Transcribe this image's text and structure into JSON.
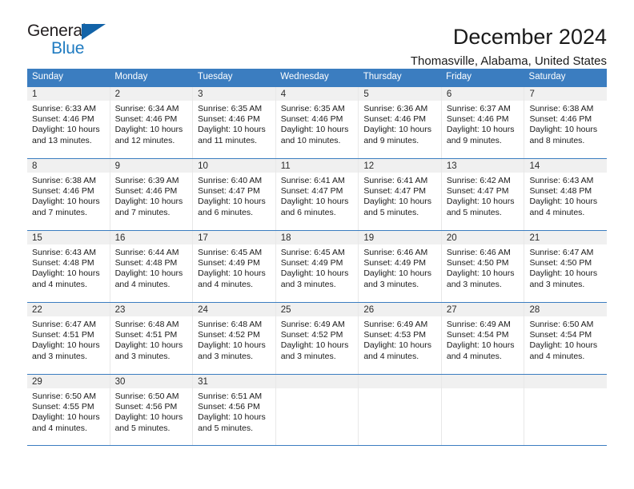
{
  "brand": {
    "name_top": "General",
    "name_bottom": "Blue",
    "triangle_icon": "brand-triangle-icon",
    "colors": {
      "general": "#231f20",
      "blue": "#1f7bc1",
      "triangle": "#1263a8"
    }
  },
  "header": {
    "title": "December 2024",
    "subtitle": "Thomasville, Alabama, United States"
  },
  "theme": {
    "header_row_bg": "#3b7dc0",
    "daynum_band_bg": "#f0f0f0",
    "rule_color": "#3b7dc0",
    "text": "#1a1a1a"
  },
  "columns": [
    "Sunday",
    "Monday",
    "Tuesday",
    "Wednesday",
    "Thursday",
    "Friday",
    "Saturday"
  ],
  "labels": {
    "sunrise_prefix": "Sunrise: ",
    "sunset_prefix": "Sunset: ",
    "daylight_prefix": "Daylight: "
  },
  "weeks": [
    [
      {
        "day": "1",
        "sunrise": "Sunrise: 6:33 AM",
        "sunset": "Sunset: 4:46 PM",
        "daylight_line1": "Daylight: 10 hours",
        "daylight_line2": "and 13 minutes."
      },
      {
        "day": "2",
        "sunrise": "Sunrise: 6:34 AM",
        "sunset": "Sunset: 4:46 PM",
        "daylight_line1": "Daylight: 10 hours",
        "daylight_line2": "and 12 minutes."
      },
      {
        "day": "3",
        "sunrise": "Sunrise: 6:35 AM",
        "sunset": "Sunset: 4:46 PM",
        "daylight_line1": "Daylight: 10 hours",
        "daylight_line2": "and 11 minutes."
      },
      {
        "day": "4",
        "sunrise": "Sunrise: 6:35 AM",
        "sunset": "Sunset: 4:46 PM",
        "daylight_line1": "Daylight: 10 hours",
        "daylight_line2": "and 10 minutes."
      },
      {
        "day": "5",
        "sunrise": "Sunrise: 6:36 AM",
        "sunset": "Sunset: 4:46 PM",
        "daylight_line1": "Daylight: 10 hours",
        "daylight_line2": "and 9 minutes."
      },
      {
        "day": "6",
        "sunrise": "Sunrise: 6:37 AM",
        "sunset": "Sunset: 4:46 PM",
        "daylight_line1": "Daylight: 10 hours",
        "daylight_line2": "and 9 minutes."
      },
      {
        "day": "7",
        "sunrise": "Sunrise: 6:38 AM",
        "sunset": "Sunset: 4:46 PM",
        "daylight_line1": "Daylight: 10 hours",
        "daylight_line2": "and 8 minutes."
      }
    ],
    [
      {
        "day": "8",
        "sunrise": "Sunrise: 6:38 AM",
        "sunset": "Sunset: 4:46 PM",
        "daylight_line1": "Daylight: 10 hours",
        "daylight_line2": "and 7 minutes."
      },
      {
        "day": "9",
        "sunrise": "Sunrise: 6:39 AM",
        "sunset": "Sunset: 4:46 PM",
        "daylight_line1": "Daylight: 10 hours",
        "daylight_line2": "and 7 minutes."
      },
      {
        "day": "10",
        "sunrise": "Sunrise: 6:40 AM",
        "sunset": "Sunset: 4:47 PM",
        "daylight_line1": "Daylight: 10 hours",
        "daylight_line2": "and 6 minutes."
      },
      {
        "day": "11",
        "sunrise": "Sunrise: 6:41 AM",
        "sunset": "Sunset: 4:47 PM",
        "daylight_line1": "Daylight: 10 hours",
        "daylight_line2": "and 6 minutes."
      },
      {
        "day": "12",
        "sunrise": "Sunrise: 6:41 AM",
        "sunset": "Sunset: 4:47 PM",
        "daylight_line1": "Daylight: 10 hours",
        "daylight_line2": "and 5 minutes."
      },
      {
        "day": "13",
        "sunrise": "Sunrise: 6:42 AM",
        "sunset": "Sunset: 4:47 PM",
        "daylight_line1": "Daylight: 10 hours",
        "daylight_line2": "and 5 minutes."
      },
      {
        "day": "14",
        "sunrise": "Sunrise: 6:43 AM",
        "sunset": "Sunset: 4:48 PM",
        "daylight_line1": "Daylight: 10 hours",
        "daylight_line2": "and 4 minutes."
      }
    ],
    [
      {
        "day": "15",
        "sunrise": "Sunrise: 6:43 AM",
        "sunset": "Sunset: 4:48 PM",
        "daylight_line1": "Daylight: 10 hours",
        "daylight_line2": "and 4 minutes."
      },
      {
        "day": "16",
        "sunrise": "Sunrise: 6:44 AM",
        "sunset": "Sunset: 4:48 PM",
        "daylight_line1": "Daylight: 10 hours",
        "daylight_line2": "and 4 minutes."
      },
      {
        "day": "17",
        "sunrise": "Sunrise: 6:45 AM",
        "sunset": "Sunset: 4:49 PM",
        "daylight_line1": "Daylight: 10 hours",
        "daylight_line2": "and 4 minutes."
      },
      {
        "day": "18",
        "sunrise": "Sunrise: 6:45 AM",
        "sunset": "Sunset: 4:49 PM",
        "daylight_line1": "Daylight: 10 hours",
        "daylight_line2": "and 3 minutes."
      },
      {
        "day": "19",
        "sunrise": "Sunrise: 6:46 AM",
        "sunset": "Sunset: 4:49 PM",
        "daylight_line1": "Daylight: 10 hours",
        "daylight_line2": "and 3 minutes."
      },
      {
        "day": "20",
        "sunrise": "Sunrise: 6:46 AM",
        "sunset": "Sunset: 4:50 PM",
        "daylight_line1": "Daylight: 10 hours",
        "daylight_line2": "and 3 minutes."
      },
      {
        "day": "21",
        "sunrise": "Sunrise: 6:47 AM",
        "sunset": "Sunset: 4:50 PM",
        "daylight_line1": "Daylight: 10 hours",
        "daylight_line2": "and 3 minutes."
      }
    ],
    [
      {
        "day": "22",
        "sunrise": "Sunrise: 6:47 AM",
        "sunset": "Sunset: 4:51 PM",
        "daylight_line1": "Daylight: 10 hours",
        "daylight_line2": "and 3 minutes."
      },
      {
        "day": "23",
        "sunrise": "Sunrise: 6:48 AM",
        "sunset": "Sunset: 4:51 PM",
        "daylight_line1": "Daylight: 10 hours",
        "daylight_line2": "and 3 minutes."
      },
      {
        "day": "24",
        "sunrise": "Sunrise: 6:48 AM",
        "sunset": "Sunset: 4:52 PM",
        "daylight_line1": "Daylight: 10 hours",
        "daylight_line2": "and 3 minutes."
      },
      {
        "day": "25",
        "sunrise": "Sunrise: 6:49 AM",
        "sunset": "Sunset: 4:52 PM",
        "daylight_line1": "Daylight: 10 hours",
        "daylight_line2": "and 3 minutes."
      },
      {
        "day": "26",
        "sunrise": "Sunrise: 6:49 AM",
        "sunset": "Sunset: 4:53 PM",
        "daylight_line1": "Daylight: 10 hours",
        "daylight_line2": "and 4 minutes."
      },
      {
        "day": "27",
        "sunrise": "Sunrise: 6:49 AM",
        "sunset": "Sunset: 4:54 PM",
        "daylight_line1": "Daylight: 10 hours",
        "daylight_line2": "and 4 minutes."
      },
      {
        "day": "28",
        "sunrise": "Sunrise: 6:50 AM",
        "sunset": "Sunset: 4:54 PM",
        "daylight_line1": "Daylight: 10 hours",
        "daylight_line2": "and 4 minutes."
      }
    ],
    [
      {
        "day": "29",
        "sunrise": "Sunrise: 6:50 AM",
        "sunset": "Sunset: 4:55 PM",
        "daylight_line1": "Daylight: 10 hours",
        "daylight_line2": "and 4 minutes."
      },
      {
        "day": "30",
        "sunrise": "Sunrise: 6:50 AM",
        "sunset": "Sunset: 4:56 PM",
        "daylight_line1": "Daylight: 10 hours",
        "daylight_line2": "and 5 minutes."
      },
      {
        "day": "31",
        "sunrise": "Sunrise: 6:51 AM",
        "sunset": "Sunset: 4:56 PM",
        "daylight_line1": "Daylight: 10 hours",
        "daylight_line2": "and 5 minutes."
      },
      {
        "day": "",
        "sunrise": "",
        "sunset": "",
        "daylight_line1": "",
        "daylight_line2": ""
      },
      {
        "day": "",
        "sunrise": "",
        "sunset": "",
        "daylight_line1": "",
        "daylight_line2": ""
      },
      {
        "day": "",
        "sunrise": "",
        "sunset": "",
        "daylight_line1": "",
        "daylight_line2": ""
      },
      {
        "day": "",
        "sunrise": "",
        "sunset": "",
        "daylight_line1": "",
        "daylight_line2": ""
      }
    ]
  ]
}
